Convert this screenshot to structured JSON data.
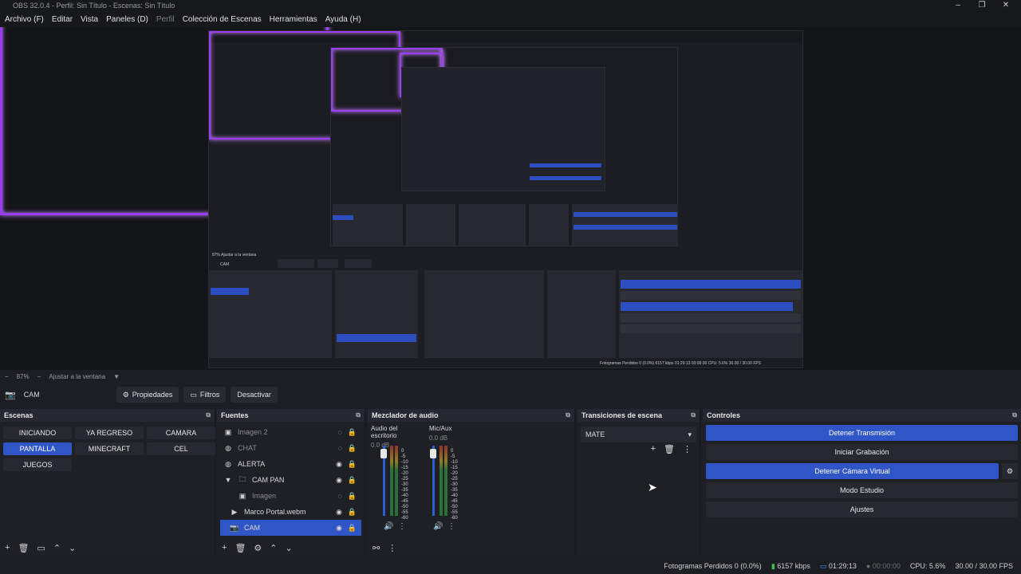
{
  "window": {
    "title": "OBS 32.0.4 - Perfil: Sin Título - Escenas: Sin Título"
  },
  "menu": [
    {
      "label": "Archivo (F)",
      "dim": false
    },
    {
      "label": "Editar",
      "dim": false
    },
    {
      "label": "Vista",
      "dim": false
    },
    {
      "label": "Paneles (D)",
      "dim": false
    },
    {
      "label": "Perfil",
      "dim": true
    },
    {
      "label": "Colección de Escenas",
      "dim": false
    },
    {
      "label": "Herramientas",
      "dim": false
    },
    {
      "label": "Ayuda (H)",
      "dim": false
    }
  ],
  "zoom": {
    "level": "87%",
    "fit_label": "Ajustar a la ventana"
  },
  "source_toolbar": {
    "name": "CAM",
    "properties": "Propiedades",
    "filters": "Filtros",
    "deactivate": "Desactivar"
  },
  "scenes": {
    "title": "Escenas",
    "items": [
      {
        "label": "INICIANDO",
        "active": false
      },
      {
        "label": "YA REGRESO",
        "active": false
      },
      {
        "label": "CAMARA",
        "active": false
      },
      {
        "label": "PANTALLA",
        "active": true
      },
      {
        "label": "MINECRAFT",
        "active": false
      },
      {
        "label": "CEL",
        "active": false
      },
      {
        "label": "JUEGOS",
        "active": false
      }
    ]
  },
  "sources": {
    "title": "Fuentes",
    "items": [
      {
        "label": "Imagen 2",
        "icon": "image-icon",
        "dim": true
      },
      {
        "label": "CHAT",
        "icon": "browser-icon",
        "dim": true
      },
      {
        "label": "ALERTA",
        "icon": "browser-icon",
        "dim": false
      },
      {
        "label": "CAM PAN",
        "icon": "folder-icon",
        "dim": false
      },
      {
        "label": "Imagen",
        "icon": "image-icon",
        "dim": true
      },
      {
        "label": "Marco Portal.webm",
        "icon": "play-icon",
        "dim": false
      },
      {
        "label": "CAM",
        "icon": "camera-icon",
        "dim": false,
        "selected": true
      }
    ]
  },
  "mixer": {
    "title": "Mezclador de audio",
    "channels": [
      {
        "name": "Audio del escritorio",
        "db": "0.0 dB"
      },
      {
        "name": "Mic/Aux",
        "db": "0.0 dB"
      }
    ],
    "scale": [
      "0",
      "-5",
      "-10",
      "-15",
      "-20",
      "-25",
      "-30",
      "-35",
      "-40",
      "-45",
      "-50",
      "-55",
      "-60"
    ]
  },
  "transitions": {
    "title": "Transiciones de escena",
    "selected": "MATE"
  },
  "controls": {
    "title": "Controles",
    "stop_stream": "Detener Transmisión",
    "start_record": "Iniciar Grabación",
    "stop_virtualcam": "Detener Cámara Virtual",
    "studio_mode": "Modo Estudio",
    "settings": "Ajustes"
  },
  "status": {
    "dropped": "Fotogramas Perdidos 0 (0.0%)",
    "bitrate": "6157 kbps",
    "stream_time": "01:29:13",
    "record_time": "00:00:00",
    "cpu": "CPU: 5.6%",
    "fps": "30.00 / 30.00 FPS"
  },
  "colors": {
    "accent": "#3055c7",
    "neon": "#9b3df0",
    "bg": "#1d1e23"
  }
}
